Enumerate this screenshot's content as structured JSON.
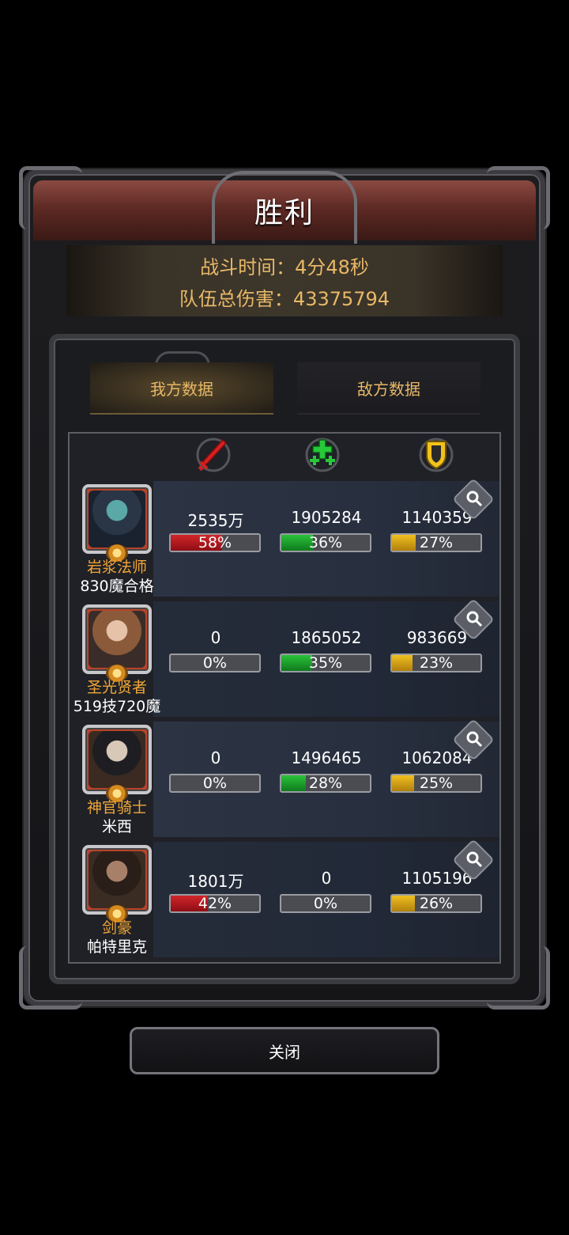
{
  "title": "胜利",
  "summary": {
    "battle_time": "战斗时间：4分48秒",
    "team_damage": "队伍总伤害：43375794"
  },
  "tabs": [
    {
      "label": "我方数据",
      "active": true
    },
    {
      "label": "敌方数据",
      "active": false
    }
  ],
  "columns": [
    {
      "icon": "sword-icon",
      "color": "#d81f1f"
    },
    {
      "icon": "heal-plus-icon",
      "color": "#27c93a"
    },
    {
      "icon": "shield-icon",
      "color": "#f2c21c"
    }
  ],
  "heroes": [
    {
      "name": "岩浆法师",
      "player": "830魔合格",
      "damage": "2535万",
      "damage_pct": "58%",
      "damage_frac": 0.58,
      "heal": "1905284",
      "heal_pct": "36%",
      "heal_frac": 0.36,
      "tank": "1140359",
      "tank_pct": "27%",
      "tank_frac": 0.27
    },
    {
      "name": "圣光贤者",
      "player": "519技720魔",
      "damage": "0",
      "damage_pct": "0%",
      "damage_frac": 0,
      "heal": "1865052",
      "heal_pct": "35%",
      "heal_frac": 0.35,
      "tank": "983669",
      "tank_pct": "23%",
      "tank_frac": 0.23
    },
    {
      "name": "神官骑士",
      "player": "米西",
      "damage": "0",
      "damage_pct": "0%",
      "damage_frac": 0,
      "heal": "1496465",
      "heal_pct": "28%",
      "heal_frac": 0.28,
      "tank": "1062084",
      "tank_pct": "25%",
      "tank_frac": 0.25
    },
    {
      "name": "剑豪",
      "player": "帕特里克",
      "damage": "1801万",
      "damage_pct": "42%",
      "damage_frac": 0.42,
      "heal": "0",
      "heal_pct": "0%",
      "heal_frac": 0,
      "tank": "1105196",
      "tank_pct": "26%",
      "tank_frac": 0.26
    }
  ],
  "close_button": "关闭"
}
